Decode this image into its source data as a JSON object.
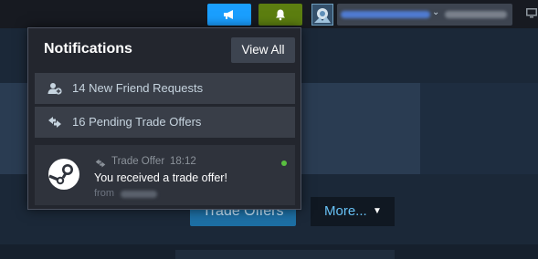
{
  "topbar": {
    "announce_icon": "megaphone-icon",
    "bell_icon": "bell-icon",
    "account_chevron": "⌄",
    "monitor_icon": "monitor-icon"
  },
  "background": {
    "trade_offers_label": "Trade Offers",
    "more_label": "More...",
    "more_caret": "▼"
  },
  "notifications": {
    "title": "Notifications",
    "view_all": "View All",
    "rows": [
      {
        "icon": "add-friend-icon",
        "label": "14 New Friend Requests"
      },
      {
        "icon": "trade-arrows-icon",
        "label": "16 Pending Trade Offers"
      }
    ],
    "item": {
      "icon": "steam-logo-icon",
      "type_icon": "trade-arrows-icon",
      "type": "Trade Offer",
      "time": "18:12",
      "message": "You received a trade offer!",
      "from_prefix": "from",
      "unread": true
    }
  },
  "colors": {
    "announce": "#1a9fff",
    "bell": "#5c7e10",
    "unread_dot": "#59bf40",
    "panel_bg": "#23262e"
  }
}
